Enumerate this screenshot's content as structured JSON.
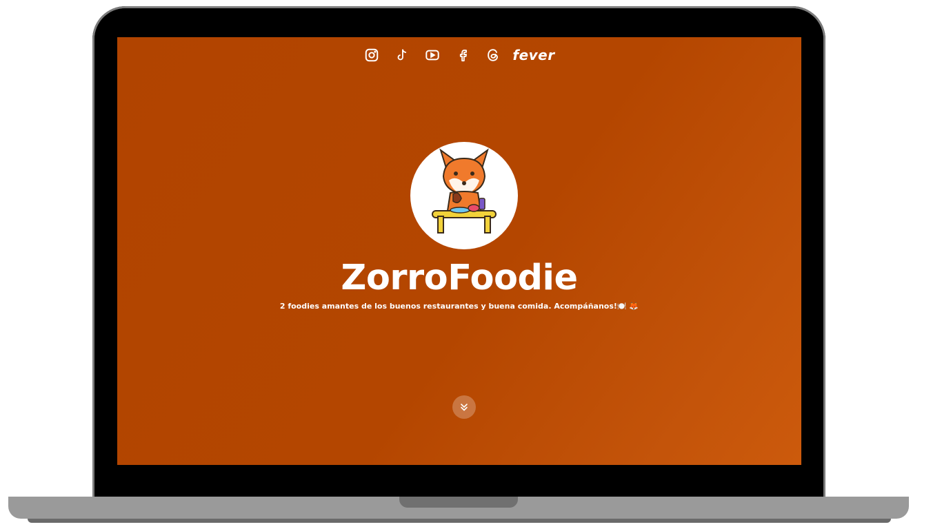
{
  "social": {
    "icons": [
      {
        "name": "instagram-icon"
      },
      {
        "name": "tiktok-icon"
      },
      {
        "name": "youtube-icon"
      },
      {
        "name": "facebook-icon"
      },
      {
        "name": "threads-icon"
      }
    ],
    "fever_label": "fever"
  },
  "profile": {
    "name": "ZorroFoodie",
    "bio": "2 foodies amantes de los buenos restaurantes y buena comida. Acompáñanos!🍽️ 🦊"
  },
  "colors": {
    "background_start": "#b14400",
    "background_end": "#cc5a0c",
    "text": "#ffffff"
  }
}
